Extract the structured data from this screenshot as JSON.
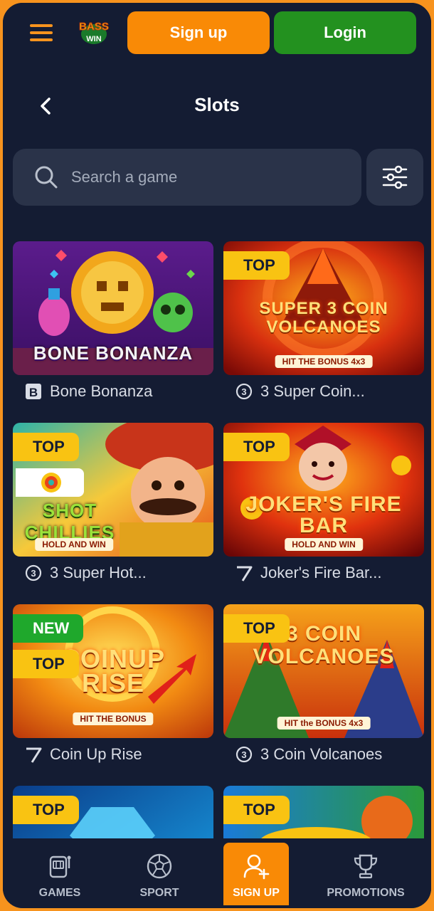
{
  "header": {
    "logo_text_top": "BASS",
    "logo_text_bottom": "WIN",
    "signup_label": "Sign up",
    "login_label": "Login"
  },
  "page": {
    "title": "Slots"
  },
  "search": {
    "placeholder": "Search a game"
  },
  "games": [
    {
      "name": "Bone Bonanza",
      "art_title": "BONE BONANZA",
      "badges": []
    },
    {
      "name": "3 Super Coin...",
      "art_title": "SUPER 3 COIN VOLCANOES",
      "art_sub": "HIT THE BONUS 4x3",
      "badges": [
        "TOP"
      ]
    },
    {
      "name": "3 Super Hot...",
      "art_title": "SHOT CHILLIES",
      "art_sub": "HOLD AND WIN",
      "badges": [
        "TOP"
      ]
    },
    {
      "name": "Joker's Fire Bar...",
      "art_title": "JOKER'S FIRE BAR",
      "art_sub": "HOLD AND WIN",
      "badges": [
        "TOP"
      ]
    },
    {
      "name": "Coin Up Rise",
      "art_title": "COINUP RISE",
      "art_sub": "HIT THE BONUS",
      "badges": [
        "NEW",
        "TOP"
      ]
    },
    {
      "name": "3 Coin Volcanoes",
      "art_title": "3 COIN VOLCANOES",
      "art_sub": "HIT the BONUS 4x3",
      "badges": [
        "TOP"
      ]
    },
    {
      "name": "",
      "badges": [
        "TOP"
      ]
    },
    {
      "name": "",
      "badges": [
        "TOP"
      ]
    }
  ],
  "nav": {
    "games": "GAMES",
    "sport": "SPORT",
    "signup": "SIGN UP",
    "promotions": "PROMOTIONS"
  },
  "colors": {
    "background": "#141c33",
    "accent_orange": "#f98a06",
    "login_green": "#23911f",
    "badge_top": "#f9c312",
    "badge_new": "#1fa82c"
  }
}
